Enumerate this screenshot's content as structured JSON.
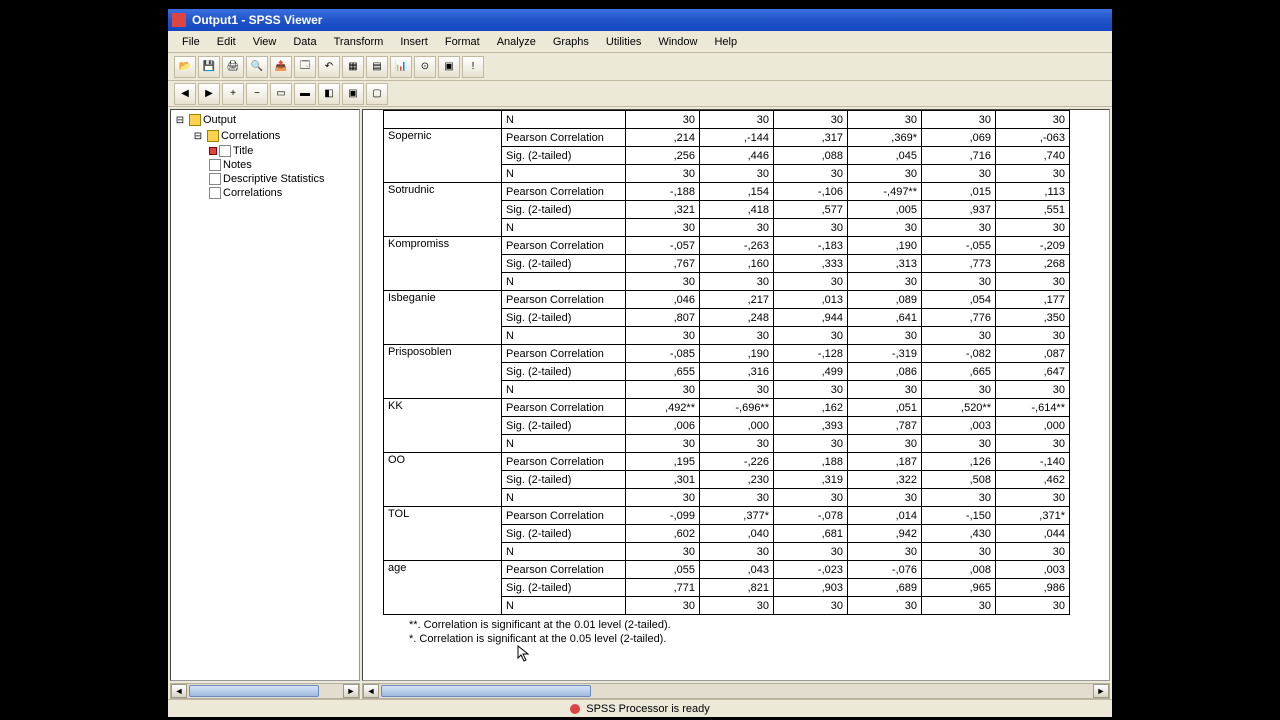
{
  "title": "Output1 - SPSS Viewer",
  "menu": [
    "File",
    "Edit",
    "View",
    "Data",
    "Transform",
    "Insert",
    "Format",
    "Analyze",
    "Graphs",
    "Utilities",
    "Window",
    "Help"
  ],
  "outline": {
    "root": "Output",
    "group": "Correlations",
    "items": [
      "Title",
      "Notes",
      "Descriptive Statistics",
      "Correlations"
    ]
  },
  "footnotes": {
    "a": "**.  Correlation is significant at the 0.01 level (2-tailed).",
    "b": "*.  Correlation is significant at the 0.05 level (2-tailed)."
  },
  "status": "SPSS Processor  is ready",
  "stat_labels": {
    "pc": "Pearson Correlation",
    "sig": "Sig. (2-tailed)",
    "n": "N"
  },
  "first_n_row": [
    "30",
    "30",
    "30",
    "30",
    "30",
    "30"
  ],
  "rows": [
    {
      "var": "Sopernic",
      "pc": [
        ",214",
        ",-144",
        ",317",
        ",369*",
        ",069",
        ",-063"
      ],
      "pc_raw": [
        ",214",
        "-,144",
        ",317",
        ",369*",
        ",069",
        "-,063"
      ],
      "sig": [
        ",256",
        ",446",
        ",088",
        ",045",
        ",716",
        ",740"
      ],
      "n": [
        "30",
        "30",
        "30",
        "30",
        "30",
        "30"
      ]
    },
    {
      "var": "Sotrudnic",
      "pc": [
        "-,188",
        ",154",
        "-,106",
        "-,497**",
        ",015",
        ",113"
      ],
      "sig": [
        ",321",
        ",418",
        ",577",
        ",005",
        ",937",
        ",551"
      ],
      "n": [
        "30",
        "30",
        "30",
        "30",
        "30",
        "30"
      ]
    },
    {
      "var": "Kompromiss",
      "pc": [
        "-,057",
        "-,263",
        "-,183",
        ",190",
        "-,055",
        "-,209"
      ],
      "sig": [
        ",767",
        ",160",
        ",333",
        ",313",
        ",773",
        ",268"
      ],
      "n": [
        "30",
        "30",
        "30",
        "30",
        "30",
        "30"
      ]
    },
    {
      "var": "Isbeganie",
      "pc": [
        ",046",
        ",217",
        ",013",
        ",089",
        ",054",
        ",177"
      ],
      "sig": [
        ",807",
        ",248",
        ",944",
        ",641",
        ",776",
        ",350"
      ],
      "n": [
        "30",
        "30",
        "30",
        "30",
        "30",
        "30"
      ]
    },
    {
      "var": "Prisposoblen",
      "pc": [
        "-,085",
        ",190",
        "-,128",
        "-,319",
        "-,082",
        ",087"
      ],
      "sig": [
        ",655",
        ",316",
        ",499",
        ",086",
        ",665",
        ",647"
      ],
      "n": [
        "30",
        "30",
        "30",
        "30",
        "30",
        "30"
      ]
    },
    {
      "var": "KK",
      "pc": [
        ",492**",
        "-,696**",
        ",162",
        ",051",
        ",520**",
        "-,614**"
      ],
      "sig": [
        ",006",
        ",000",
        ",393",
        ",787",
        ",003",
        ",000"
      ],
      "n": [
        "30",
        "30",
        "30",
        "30",
        "30",
        "30"
      ]
    },
    {
      "var": "OO",
      "pc": [
        ",195",
        "-,226",
        ",188",
        ",187",
        ",126",
        "-,140"
      ],
      "sig": [
        ",301",
        ",230",
        ",319",
        ",322",
        ",508",
        ",462"
      ],
      "n": [
        "30",
        "30",
        "30",
        "30",
        "30",
        "30"
      ]
    },
    {
      "var": "TOL",
      "pc": [
        "-,099",
        ",377*",
        "-,078",
        ",014",
        "-,150",
        ",371*"
      ],
      "sig": [
        ",602",
        ",040",
        ",681",
        ",942",
        ",430",
        ",044"
      ],
      "n": [
        "30",
        "30",
        "30",
        "30",
        "30",
        "30"
      ]
    },
    {
      "var": "age",
      "pc": [
        ",055",
        ",043",
        "-,023",
        "-,076",
        ",008",
        ",003"
      ],
      "sig": [
        ",771",
        ",821",
        ",903",
        ",689",
        ",965",
        ",986"
      ],
      "n": [
        "30",
        "30",
        "30",
        "30",
        "30",
        "30"
      ]
    }
  ]
}
